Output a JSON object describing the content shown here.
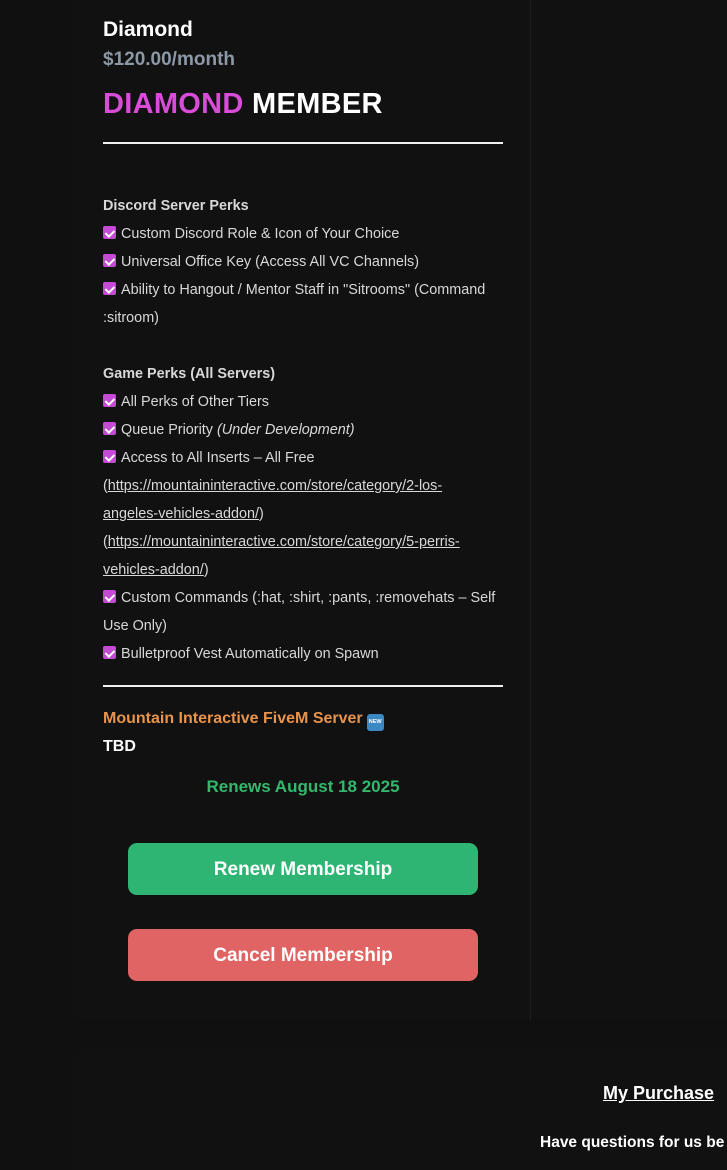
{
  "plan": {
    "name": "Diamond",
    "price": "$120.00/month",
    "headline_accent": "DIAMOND",
    "headline_rest": "MEMBER"
  },
  "discord_perks": {
    "title": "Discord Server Perks",
    "items": [
      "Custom Discord Role & Icon of Your Choice",
      "Universal Office Key (Access All VC Channels)",
      "Ability to Hangout / Mentor Staff in \"Sitrooms\" (Command",
      ":sitroom)"
    ]
  },
  "game_perks": {
    "title": "Game Perks (All Servers)",
    "item1": "All Perks of Other Tiers",
    "item2_text": "Queue Priority",
    "item2_note": "(Under Development)",
    "item3": "Access to All Inserts – All Free",
    "link1_open": "(",
    "link1_part1": "https://mountaininteractive.com/store/category/2-los-",
    "link1_part2": "angeles-vehicles-addon/",
    "link1_close": ")",
    "link2_open": "(",
    "link2_part1": "https://mountaininteractive.com/store/category/5-perris-",
    "link2_part2": "vehicles-addon/",
    "link2_close": ")",
    "item4_line1": "Custom Commands (:hat, :shirt, :pants, :removehats – Self",
    "item4_line2": "Use Only)",
    "item5": "Bulletproof Vest Automatically on Spawn"
  },
  "server": {
    "name": "Mountain Interactive FiveM Server",
    "badge": "NEW",
    "value": "TBD"
  },
  "renewal": {
    "text": "Renews August 18 2025"
  },
  "actions": {
    "renew_label": "Renew Membership",
    "cancel_label": "Cancel Membership"
  },
  "footer": {
    "purchases_link": "My Purchase",
    "questions_text": "Have questions for us be"
  },
  "colors": {
    "background": "#101010",
    "accent_purple": "#d94bd9",
    "renew_green": "#2fb573",
    "cancel_red": "#e06464",
    "server_orange": "#e8944c",
    "price_gray": "#8d98a6"
  }
}
